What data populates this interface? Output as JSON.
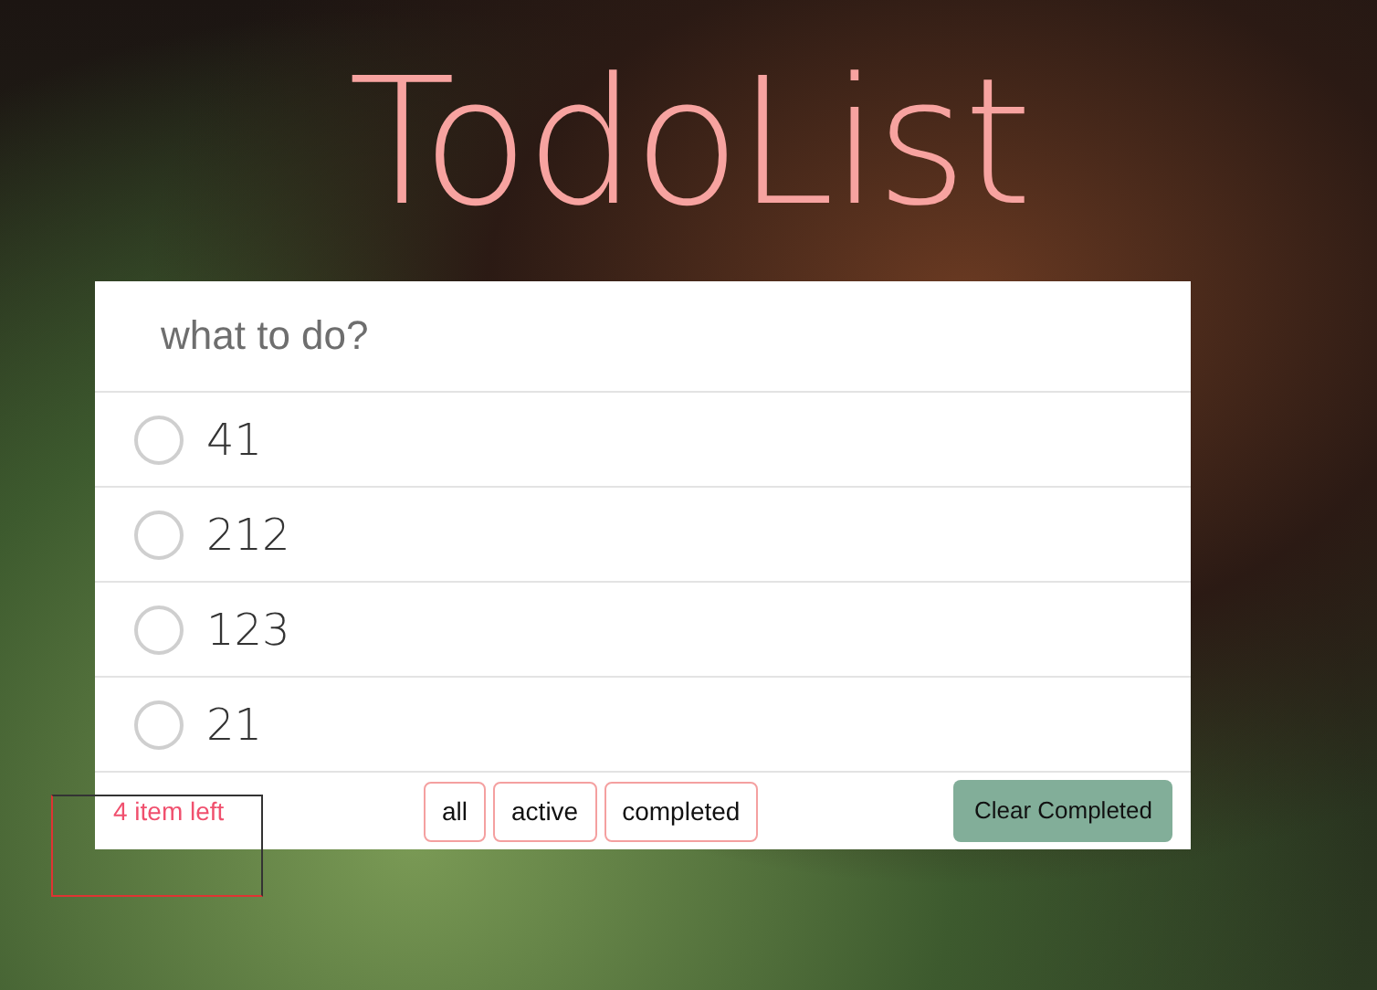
{
  "title": "TodoList",
  "input": {
    "placeholder": "what to do?"
  },
  "todos": [
    {
      "text": "41",
      "completed": false
    },
    {
      "text": "212",
      "completed": false
    },
    {
      "text": "123",
      "completed": false
    },
    {
      "text": "21",
      "completed": false
    }
  ],
  "footer": {
    "count": "4 item left",
    "highlighted": true,
    "filters": [
      "all",
      "active",
      "completed"
    ],
    "clear_button": "Clear Completed"
  }
}
